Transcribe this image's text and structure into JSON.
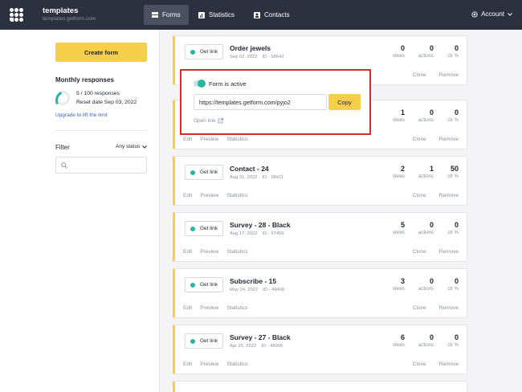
{
  "header": {
    "workspace_name": "templates",
    "workspace_domain": "templates.getform.com",
    "nav": [
      {
        "label": "Forms",
        "icon": "forms-icon",
        "active": true
      },
      {
        "label": "Statistics",
        "icon": "statistics-icon",
        "active": false
      },
      {
        "label": "Contacts",
        "icon": "contacts-icon",
        "active": false
      }
    ],
    "account_label": "Account"
  },
  "sidebar": {
    "create_label": "Create form",
    "monthly_title": "Monthly responses",
    "responses_text": "5 / 100 responses",
    "reset_text": "Reset date Sep 03, 2022",
    "responses_used_fraction": 0.05,
    "upgrade_label": "Upgrade to lift the limit",
    "filter_title": "Filter",
    "status_label": "Any status",
    "search_placeholder": ""
  },
  "labels": {
    "get_link": "Get link",
    "views": "views",
    "actions": "actions",
    "ctr": "ctr %",
    "edit": "Edit",
    "preview": "Preview",
    "statistics": "Statistics",
    "clone": "Clone",
    "remove": "Remove"
  },
  "popup": {
    "active_label": "Form is active",
    "url": "https://templates.getform.com/pyjo2",
    "copy_label": "Copy",
    "open_link_label": "Open link"
  },
  "forms": [
    {
      "name": "Order jewels",
      "date": "Sep 02, 2022",
      "id": "ID - 58642",
      "views": "0",
      "actions": "0",
      "ctr": "0"
    },
    {
      "name": "",
      "date": "",
      "id": "",
      "views": "1",
      "actions": "0",
      "ctr": "0"
    },
    {
      "name": "Contact - 24",
      "date": "Aug 31, 2022",
      "id": "ID - 58411",
      "views": "2",
      "actions": "1",
      "ctr": "50"
    },
    {
      "name": "Survey - 28 - Black",
      "date": "Aug 17, 2022",
      "id": "ID - 57456",
      "views": "5",
      "actions": "0",
      "ctr": "0"
    },
    {
      "name": "Subscribe - 15",
      "date": "May 24, 2022",
      "id": "ID - 49468",
      "views": "3",
      "actions": "0",
      "ctr": "0"
    },
    {
      "name": "Survey - 27 - Black",
      "date": "Apr 25, 2022",
      "id": "ID - 48906",
      "views": "6",
      "actions": "0",
      "ctr": "0"
    }
  ],
  "colors": {
    "topbar": "#2c3140",
    "accent_yellow": "#f5cf4a",
    "active_green": "#2bb5a3",
    "highlight_red": "#d92b2b"
  }
}
